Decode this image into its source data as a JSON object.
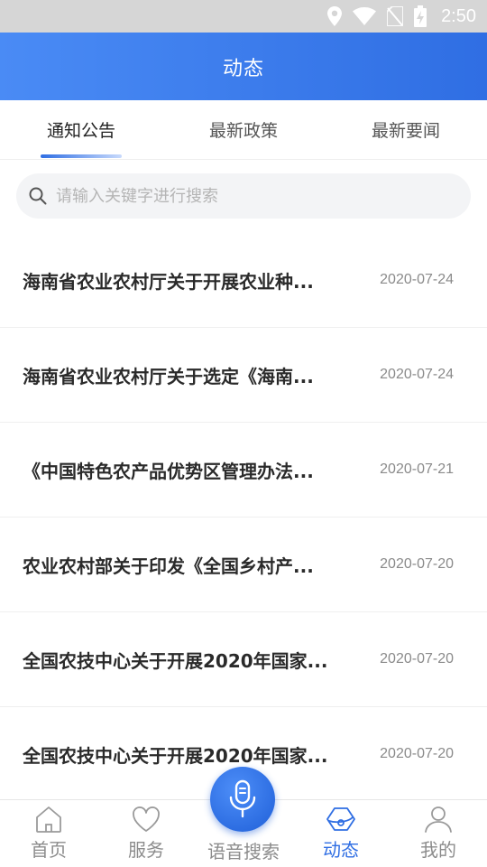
{
  "status_bar": {
    "time": "2:50"
  },
  "header": {
    "title": "动态"
  },
  "tabs": [
    {
      "label": "通知公告",
      "active": true
    },
    {
      "label": "最新政策",
      "active": false
    },
    {
      "label": "最新要闻",
      "active": false
    }
  ],
  "search": {
    "placeholder": "请输入关键字进行搜索"
  },
  "news": [
    {
      "title": "海南省农业农村厅关于开展农业种...",
      "date": "2020-07-24"
    },
    {
      "title": "海南省农业农村厅关于选定《海南...",
      "date": "2020-07-24"
    },
    {
      "title": "《中国特色农产品优势区管理办法...",
      "date": "2020-07-21"
    },
    {
      "title": "农业农村部关于印发《全国乡村产...",
      "date": "2020-07-20"
    },
    {
      "title": "全国农技中心关于开展2020年国家...",
      "date": "2020-07-20"
    },
    {
      "title": "全国农技中心关于开展2020年国家...",
      "date": "2020-07-20"
    }
  ],
  "bottom_nav": [
    {
      "label": "首页",
      "icon": "home-icon"
    },
    {
      "label": "服务",
      "icon": "heart-icon"
    },
    {
      "label": "语音搜索",
      "icon": "microphone-icon"
    },
    {
      "label": "动态",
      "icon": "hexagon-icon",
      "active": true
    },
    {
      "label": "我的",
      "icon": "user-icon"
    }
  ],
  "colors": {
    "accent": "#2f6ee3",
    "header_gradient_start": "#4a8bf5",
    "status_bar": "#d6d6d6"
  }
}
